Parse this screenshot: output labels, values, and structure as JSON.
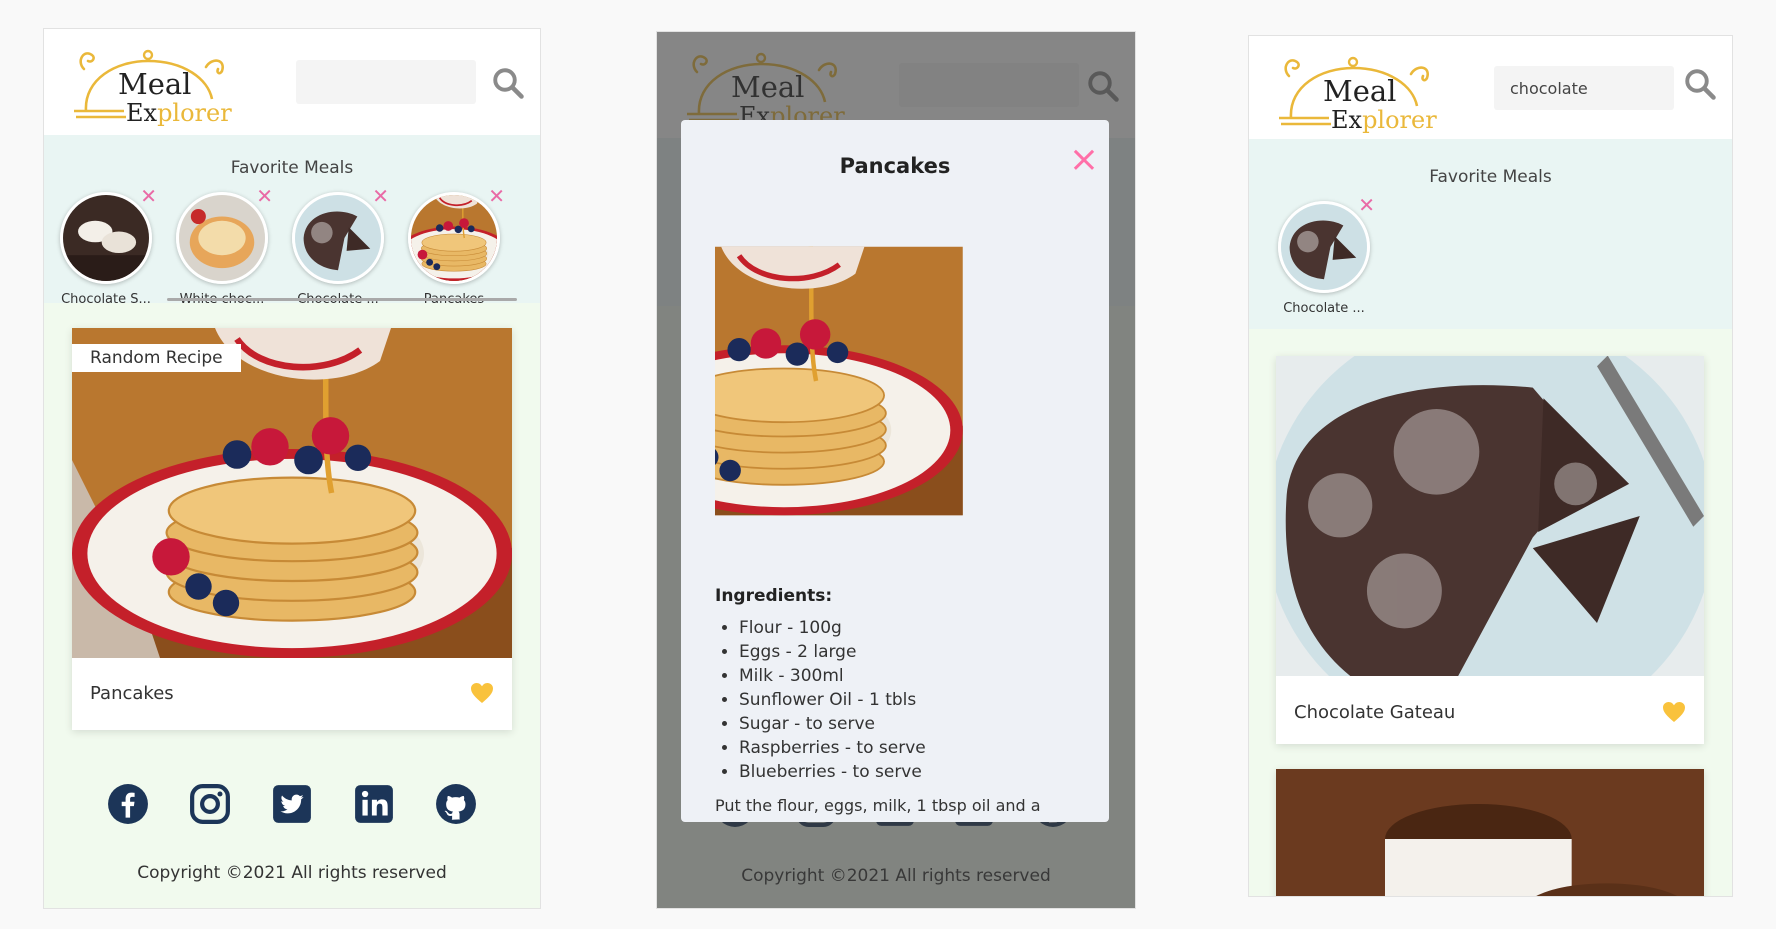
{
  "app": {
    "logo_word1": "Meal",
    "logo_word2_a": "Ex",
    "logo_word2_b": "plorer",
    "accent_color": "#eab83a",
    "favorite_title": "Favorite Meals",
    "random_tag": "Random Recipe",
    "copyright": "Copyright ©2021 All rights reserved",
    "social_icons": [
      "facebook-icon",
      "instagram-icon",
      "twitter-icon",
      "linkedin-icon",
      "github-icon"
    ]
  },
  "screen1": {
    "search_value": "",
    "favorites": [
      {
        "name": "Chocolate S..."
      },
      {
        "name": "White choc..."
      },
      {
        "name": "Chocolate ..."
      },
      {
        "name": "Pancakes"
      }
    ],
    "card": {
      "name": "Pancakes"
    }
  },
  "screen2": {
    "search_value": "",
    "modal": {
      "title": "Pancakes",
      "close": "×",
      "ingredients_title": "Ingredients:",
      "ingredients": [
        "Flour - 100g",
        "Eggs - 2 large",
        "Milk - 300ml",
        "Sunflower Oil - 1 tbls",
        "Sugar - to serve",
        "Raspberries - to serve",
        "Blueberries - to serve"
      ],
      "instructions": "Put the flour, eggs, milk, 1 tbsp oil and a"
    }
  },
  "screen3": {
    "search_value": "chocolate",
    "favorites": [
      {
        "name": "Chocolate ..."
      }
    ],
    "card": {
      "name": "Chocolate Gateau"
    }
  }
}
